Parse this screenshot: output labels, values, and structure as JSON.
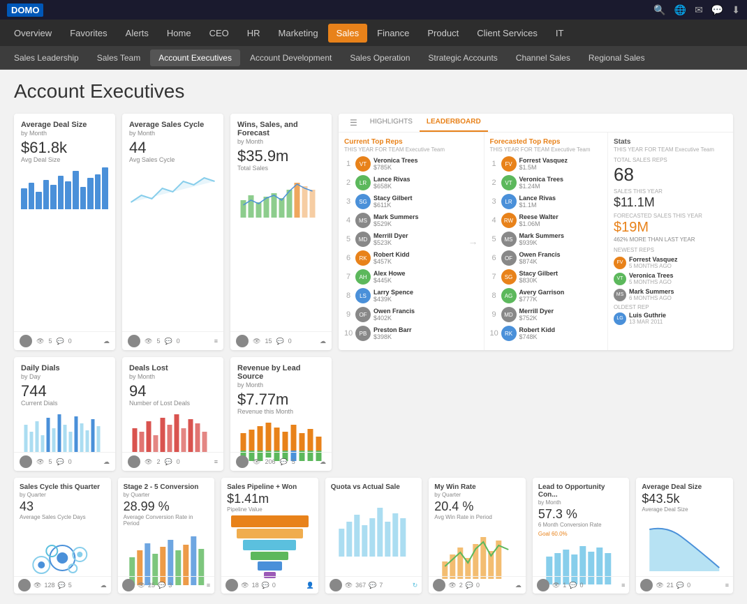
{
  "app": {
    "logo": "DOMO",
    "top_icons": [
      "🔍",
      "🌐",
      "✉",
      "💬",
      "⬇"
    ]
  },
  "nav1": {
    "items": [
      {
        "label": "Overview",
        "active": false
      },
      {
        "label": "Favorites",
        "active": false
      },
      {
        "label": "Alerts",
        "active": false
      },
      {
        "label": "Home",
        "active": false
      },
      {
        "label": "CEO",
        "active": false
      },
      {
        "label": "HR",
        "active": false
      },
      {
        "label": "Marketing",
        "active": false
      },
      {
        "label": "Sales",
        "active": true
      },
      {
        "label": "Finance",
        "active": false
      },
      {
        "label": "Product",
        "active": false
      },
      {
        "label": "Client Services",
        "active": false
      },
      {
        "label": "IT",
        "active": false
      }
    ]
  },
  "nav2": {
    "items": [
      {
        "label": "Sales Leadership",
        "active": false
      },
      {
        "label": "Sales Team",
        "active": false
      },
      {
        "label": "Account Executives",
        "active": true
      },
      {
        "label": "Account Development",
        "active": false
      },
      {
        "label": "Sales Operation",
        "active": false
      },
      {
        "label": "Strategic Accounts",
        "active": false
      },
      {
        "label": "Channel Sales",
        "active": false
      },
      {
        "label": "Regional Sales",
        "active": false
      }
    ]
  },
  "page": {
    "title": "Account Executives"
  },
  "cards": {
    "avg_deal_size": {
      "title": "Average Deal Size",
      "subtitle": "by Month",
      "value": "$61.8k",
      "value_label": "Avg Deal Size"
    },
    "avg_sales_cycle": {
      "title": "Average Sales Cycle",
      "subtitle": "by Month",
      "value": "44",
      "value_label": "Avg Sales Cycle"
    },
    "wins_sales": {
      "title": "Wins, Sales, and Forecast",
      "subtitle": "by Month",
      "value": "$35.9m",
      "value_label": "Total Sales"
    },
    "daily_dials": {
      "title": "Daily Dials",
      "subtitle": "by Day",
      "value": "744",
      "value_label": "Current Dials"
    },
    "deals_lost": {
      "title": "Deals Lost",
      "subtitle": "by Month",
      "value": "94",
      "value_label": "Number of Lost Deals"
    },
    "revenue_lead": {
      "title": "Revenue by Lead Source",
      "subtitle": "by Month",
      "value": "$7.77m",
      "value_label": "Revenue this Month"
    }
  },
  "leaderboard": {
    "tabs": [
      "HIGHLIGHTS",
      "LEADERBOARD"
    ],
    "current_top": {
      "title": "Current Top Reps",
      "subtitle": "THIS YEAR FOR TEAM Executive Team",
      "reps": [
        {
          "rank": 1,
          "name": "Veronica Trees",
          "value": "$785K",
          "initials": "VT",
          "color": "#e8821a"
        },
        {
          "rank": 2,
          "name": "Lance Rivas",
          "value": "$658K",
          "initials": "LR",
          "color": "#5cb85c"
        },
        {
          "rank": 3,
          "name": "Stacy Gilbert",
          "value": "$611K",
          "initials": "SG",
          "color": "#4a90d9"
        },
        {
          "rank": 4,
          "name": "Mark Summers",
          "value": "$529K",
          "initials": "MS",
          "color": "#888"
        },
        {
          "rank": 5,
          "name": "Merrill Dyer",
          "value": "$523K",
          "initials": "MD",
          "color": "#888"
        },
        {
          "rank": 6,
          "name": "Robert Kidd",
          "value": "$457K",
          "initials": "RK",
          "color": "#e8821a"
        },
        {
          "rank": 7,
          "name": "Alex Howe",
          "value": "$445K",
          "initials": "AH",
          "color": "#5cb85c"
        },
        {
          "rank": 8,
          "name": "Larry Spence",
          "value": "$439K",
          "initials": "LS",
          "color": "#4a90d9"
        },
        {
          "rank": 9,
          "name": "Owen Francis",
          "value": "$402K",
          "initials": "OF",
          "color": "#888"
        },
        {
          "rank": 10,
          "name": "Preston Barr",
          "value": "$398K",
          "initials": "PB",
          "color": "#888"
        }
      ]
    },
    "forecasted_top": {
      "title": "Forecasted Top Reps",
      "subtitle": "THIS YEAR FOR TEAM Executive Team",
      "reps": [
        {
          "rank": 1,
          "name": "Forrest Vasquez",
          "value": "$1.5M",
          "initials": "FV",
          "color": "#e8821a"
        },
        {
          "rank": 2,
          "name": "Veronica Trees",
          "value": "$1.24M",
          "initials": "VT",
          "color": "#5cb85c"
        },
        {
          "rank": 3,
          "name": "Lance Rivas",
          "value": "$1.1M",
          "initials": "LR",
          "color": "#4a90d9"
        },
        {
          "rank": 4,
          "name": "Reese Walter",
          "value": "$1.06M",
          "initials": "RW",
          "color": "#e8821a"
        },
        {
          "rank": 5,
          "name": "Mark Summers",
          "value": "$939K",
          "initials": "MS",
          "color": "#888"
        },
        {
          "rank": 6,
          "name": "Owen Francis",
          "value": "$874K",
          "initials": "OF",
          "color": "#888"
        },
        {
          "rank": 7,
          "name": "Stacy Gilbert",
          "value": "$830K",
          "initials": "SG",
          "color": "#e8821a"
        },
        {
          "rank": 8,
          "name": "Avery Garrison",
          "value": "$777K",
          "initials": "AG",
          "color": "#5cb85c"
        },
        {
          "rank": 9,
          "name": "Merrill Dyer",
          "value": "$752K",
          "initials": "MD",
          "color": "#888"
        },
        {
          "rank": 10,
          "name": "Robert Kidd",
          "value": "$748K",
          "initials": "RK",
          "color": "#4a90d9"
        }
      ]
    },
    "stats": {
      "title": "Stats",
      "subtitle": "THIS YEAR FOR TEAM Executive Team",
      "total_reps_label": "TOTAL SALES REPS",
      "total_reps": "68",
      "sales_year_label": "SALES THIS YEAR",
      "sales_year": "$11.1M",
      "forecasted_label": "FORECASTED SALES THIS YEAR",
      "forecasted": "$19M",
      "forecasted_pct": "462% MORE THAN LAST YEAR",
      "newest_reps_label": "NEWEST REPS",
      "newest_reps": [
        {
          "name": "Forrest Vasquez",
          "time": "5 MONTHS AGO"
        },
        {
          "name": "Veronica Trees",
          "time": "5 MONTHS AGO"
        },
        {
          "name": "Mark Summers",
          "time": "6 MONTHS AGO"
        }
      ],
      "oldest_label": "OLDEST REP",
      "oldest_rep": {
        "name": "Luis Guthrie",
        "time": "13 MAR 2011"
      }
    }
  },
  "bottom_cards": {
    "sales_cycle_quarter": {
      "title": "Sales Cycle this Quarter",
      "subtitle": "by Quarter",
      "value": "43",
      "value_label": "Average Sales Cycle Days"
    },
    "stage_conversion": {
      "title": "Stage 2 - 5 Conversion",
      "subtitle": "by Quarter",
      "value": "28.99 %",
      "value_label": "Average Conversion Rate in Period"
    },
    "sales_pipeline": {
      "title": "Sales Pipeline + Won",
      "subtitle": "",
      "value": "$1.41m",
      "value_label": "Pipeline Value"
    },
    "quota_actual": {
      "title": "Quota vs Actual Sale",
      "subtitle": "",
      "value": "",
      "value_label": ""
    },
    "win_rate": {
      "title": "My Win Rate",
      "subtitle": "by Quarter",
      "value": "20.4 %",
      "value_label": "Avg Win Rate in Period"
    },
    "lead_opportunity": {
      "title": "Lead to Opportunity Con...",
      "subtitle": "by Month",
      "value": "57.3 %",
      "value_label": "6 Month Conversion Rate",
      "goal_label": "Goal 60.0%"
    },
    "avg_deal_size2": {
      "title": "Average Deal Size",
      "subtitle": "",
      "value": "$43.5k",
      "value_label": "Average Deal Size"
    }
  },
  "footer_meta": {
    "card1": {
      "views": "5",
      "comments": "0"
    },
    "card2": {
      "views": "5",
      "comments": "0"
    },
    "card3": {
      "views": "15",
      "comments": "0"
    },
    "card4": {
      "views": "5",
      "comments": "0"
    },
    "card5": {
      "views": "2",
      "comments": "0"
    },
    "card6": {
      "views": "206",
      "comments": "5"
    }
  }
}
